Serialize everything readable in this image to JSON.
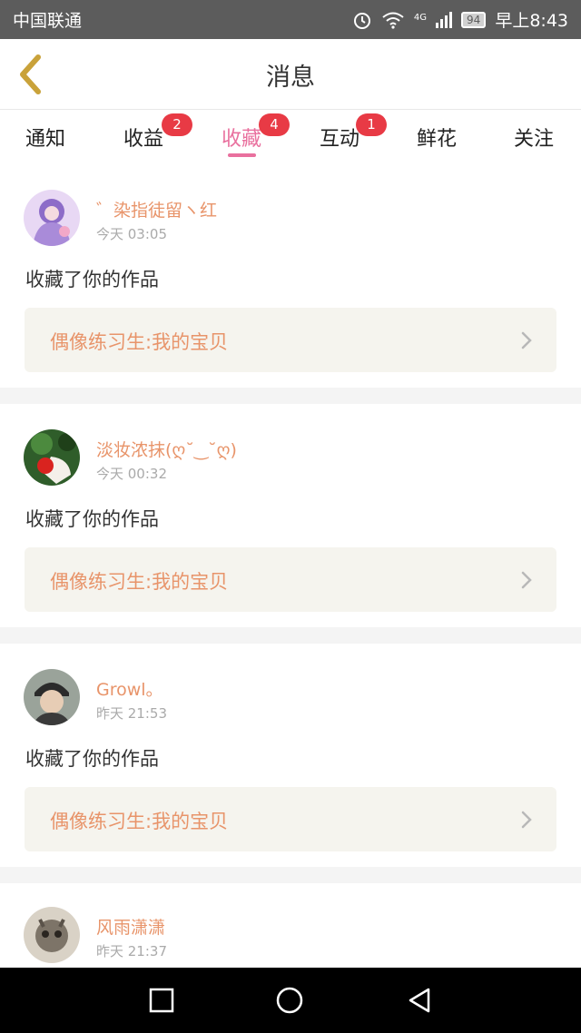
{
  "status_bar": {
    "carrier": "中国联通",
    "network": "4G",
    "battery": "94",
    "time": "早上8:43"
  },
  "header": {
    "title": "消息"
  },
  "tabs": [
    {
      "label": "通知",
      "badge": ""
    },
    {
      "label": "收益",
      "badge": "2"
    },
    {
      "label": "收藏",
      "badge": "4",
      "active": true
    },
    {
      "label": "互动",
      "badge": "1"
    },
    {
      "label": "鲜花",
      "badge": ""
    },
    {
      "label": "关注",
      "badge": ""
    }
  ],
  "feed": [
    {
      "username": "゛染指徒留ヽ红",
      "timestamp": "今天 03:05",
      "action": "收藏了你的作品",
      "work_title": "偶像练习生:我的宝贝"
    },
    {
      "username": "淡妆浓抹(ღ˘‿˘ღ)",
      "timestamp": "今天 00:32",
      "action": "收藏了你的作品",
      "work_title": "偶像练习生:我的宝贝"
    },
    {
      "username": "Growl。",
      "timestamp": "昨天 21:53",
      "action": "收藏了你的作品",
      "work_title": "偶像练习生:我的宝贝"
    },
    {
      "username": "风雨潇潇",
      "timestamp": "昨天 21:37"
    }
  ],
  "colors": {
    "accent": "#e9709e",
    "badge": "#e83a45",
    "username": "#e8946a",
    "back_arrow": "#c9a23a",
    "card_link_bg": "#f5f4ee"
  }
}
